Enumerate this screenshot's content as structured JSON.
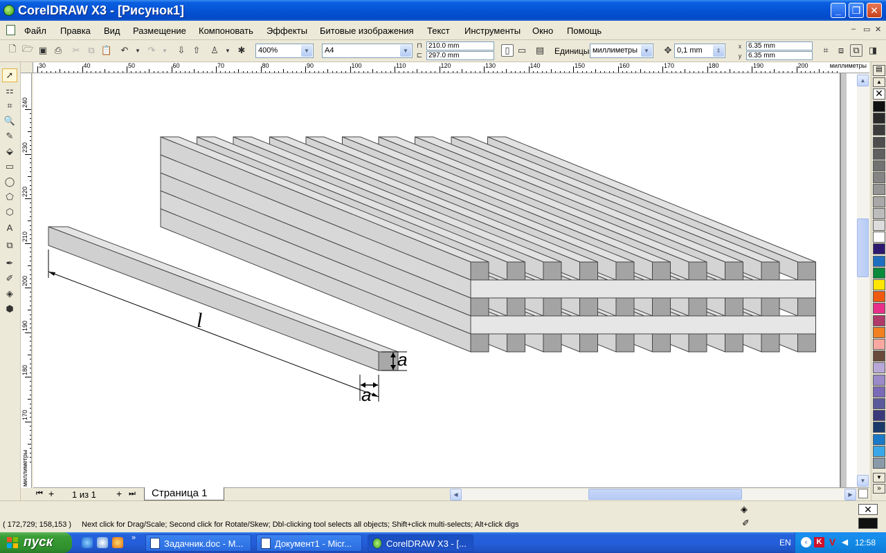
{
  "window": {
    "title": "CorelDRAW X3 - [Рисунок1]",
    "min_glyph": "_",
    "max_glyph": "❐",
    "close_glyph": "✕"
  },
  "menu": {
    "items": [
      "Файл",
      "Правка",
      "Вид",
      "Размещение",
      "Компоновать",
      "Эффекты",
      "Битовые изображения",
      "Текст",
      "Инструменты",
      "Окно",
      "Помощь"
    ]
  },
  "toolbar": {
    "zoom": "400%",
    "paper_size": "A4",
    "page_width": "210.0 mm",
    "page_height": "297.0 mm",
    "units_label": "Единицы:",
    "units_value": "миллиметры",
    "nudge": "0,1 mm",
    "duplicate_x": "6.35 mm",
    "duplicate_y": "6.35 mm",
    "dup_x_label": "x",
    "dup_y_label": "y"
  },
  "ruler": {
    "unit_label": "миллиметры",
    "h_ticks": [
      "30",
      "40",
      "50",
      "60",
      "70",
      "80",
      "90",
      "100",
      "110",
      "120",
      "130",
      "140",
      "150",
      "160",
      "170",
      "180",
      "190",
      "200"
    ],
    "v_ticks": [
      "240",
      "230",
      "220",
      "210",
      "200",
      "190",
      "180",
      "170"
    ],
    "v_unit_label": "миллиметры"
  },
  "drawing": {
    "label_length": "l",
    "label_side_a_vertical": "a",
    "label_side_a_horizontal": "a"
  },
  "pages": {
    "counter": "1 из 1",
    "tab_label": "Страница 1"
  },
  "status": {
    "coordinates": "( 172,729; 158,153 )",
    "hint": "Next click for Drag/Scale; Second click for Rotate/Skew; Dbl-clicking tool selects all objects; Shift+click multi-selects; Alt+click digs"
  },
  "palette": {
    "colors": [
      "#111111",
      "#2a2a2a",
      "#3c3c3c",
      "#4e4e4e",
      "#606060",
      "#727272",
      "#848484",
      "#969696",
      "#a8a8a8",
      "#bcbcbc",
      "#dcdcdc",
      "#ffffff",
      "#2d1a6e",
      "#1e6fc0",
      "#0a8a3a",
      "#ffe600",
      "#f05a10",
      "#e8308a",
      "#b03a6a",
      "#f08020",
      "#f8a8a0",
      "#6a4a3a",
      "#b8a8d8",
      "#9a8ac8",
      "#7a6ab8",
      "#5a5a9a",
      "#3a3a7a",
      "#1a3a6a",
      "#1a7ac8",
      "#3aa8e8",
      "#8a9aa8"
    ]
  },
  "taskbar": {
    "start_label": "пуск",
    "tasks": [
      "Задачник.doc - M...",
      "Документ1 - Micr...",
      "CorelDRAW X3 - [..."
    ],
    "lang": "EN",
    "clock": "12:58"
  }
}
